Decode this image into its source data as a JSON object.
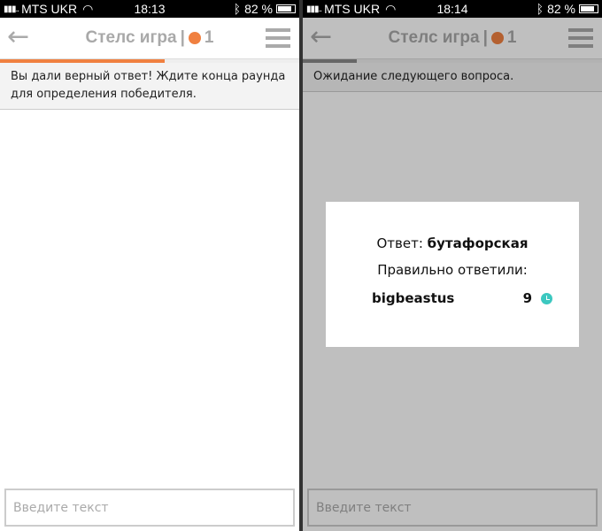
{
  "screens": [
    {
      "status": {
        "carrier": "MTS UKR",
        "time": "18:13",
        "battery": "82 %"
      },
      "header": {
        "title": "Стелс игра",
        "separator": "|",
        "count": "1"
      },
      "progress": 0.55,
      "message": "Вы дали верный ответ! Ждите конца раунда для определения победителя.",
      "input_placeholder": "Введите текст"
    },
    {
      "status": {
        "carrier": "MTS UKR",
        "time": "18:14",
        "battery": "82 %"
      },
      "header": {
        "title": "Стелс игра",
        "separator": "|",
        "count": "1"
      },
      "progress": 0.18,
      "message": "Ожидание следующего вопроса.",
      "input_placeholder": "Введите текст",
      "modal": {
        "answer_label": "Ответ:",
        "answer": "бутафорская",
        "correct_label": "Правильно ответили:",
        "players": [
          {
            "name": "bigbeastus",
            "score": "9"
          }
        ]
      }
    }
  ],
  "colors": {
    "accent": "#f08040",
    "clock": "#3cc8c0"
  }
}
